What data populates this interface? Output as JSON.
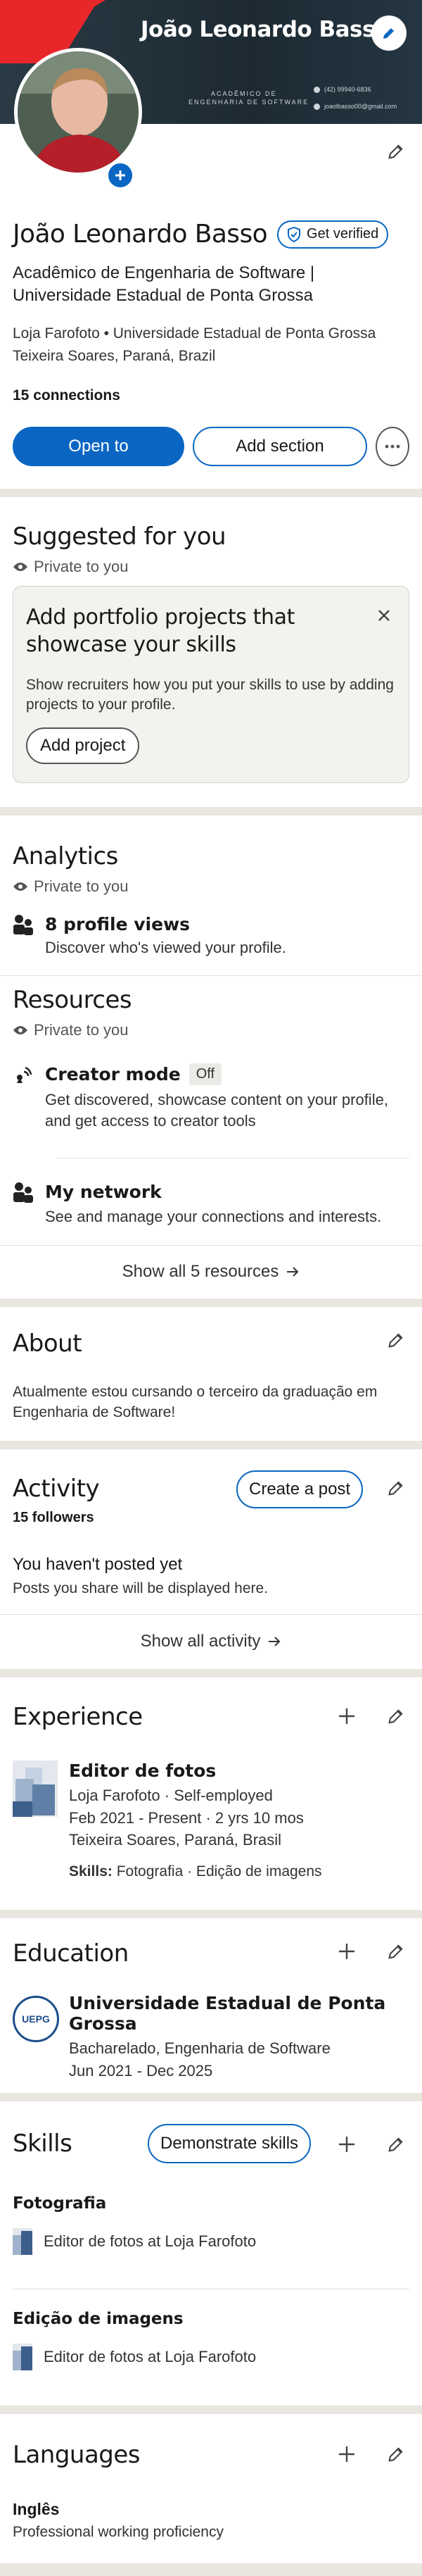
{
  "header": {
    "banner_name": "João Leonardo Basso",
    "banner_subtitle_line1": "ACADÊMICO DE",
    "banner_subtitle_line2": "ENGENHARIA DE SOFTWARE",
    "banner_phone": "(42) 99940-6836",
    "banner_email": "joaolbasso00@gmail.com"
  },
  "profile": {
    "name": "João Leonardo Basso",
    "verify_label": "Get verified",
    "headline": "Acadêmico de Engenharia de Software | Universidade Estadual de Ponta Grossa",
    "company_line": "Loja Farofoto • Universidade Estadual de Ponta Grossa",
    "location": "Teixeira Soares, Paraná, Brazil",
    "connections": "15 connections",
    "open_to_label": "Open to",
    "add_section_label": "Add section"
  },
  "suggested": {
    "title": "Suggested for you",
    "private_label": "Private to you",
    "card_title": "Add portfolio projects that showcase your skills",
    "card_text": "Show recruiters how you put your skills to use by adding projects to your profile.",
    "card_button": "Add project"
  },
  "analytics": {
    "title": "Analytics",
    "private_label": "Private to you",
    "views_title": "8 profile views",
    "views_sub": "Discover who's viewed your profile."
  },
  "resources": {
    "title": "Resources",
    "private_label": "Private to you",
    "creator_title": "Creator mode",
    "creator_badge": "Off",
    "creator_sub": "Get discovered, showcase content on your profile, and get access to creator tools",
    "network_title": "My network",
    "network_sub": "See and manage your connections and interests.",
    "show_all": "Show all 5 resources"
  },
  "about": {
    "title": "About",
    "text": "Atualmente estou cursando o terceiro da graduação em Engenharia de Software!"
  },
  "activity": {
    "title": "Activity",
    "followers": "15 followers",
    "create_post": "Create a post",
    "empty_title": "You haven't posted yet",
    "empty_sub": "Posts you share will be displayed here.",
    "show_all": "Show all activity"
  },
  "experience": {
    "title": "Experience",
    "role": "Editor de fotos",
    "company": "Loja Farofoto · Self-employed",
    "dates": "Feb 2021 - Present · 2 yrs 10 mos",
    "location": "Teixeira Soares, Paraná, Brasil",
    "skills_label": "Skills:",
    "skills": "Fotografia · Edição de imagens"
  },
  "education": {
    "title": "Education",
    "school": "Universidade Estadual de Ponta Grossa",
    "degree": "Bacharelado, Engenharia de Software",
    "dates": "Jun 2021 - Dec 2025",
    "logo_text": "UEPG"
  },
  "skills": {
    "title": "Skills",
    "demonstrate": "Demonstrate skills",
    "items": [
      {
        "name": "Fotografia",
        "context": "Editor de fotos at Loja Farofoto"
      },
      {
        "name": "Edição de imagens",
        "context": "Editor de fotos at Loja Farofoto"
      }
    ]
  },
  "languages": {
    "title": "Languages",
    "name": "Inglês",
    "level": "Professional working proficiency"
  },
  "colors": {
    "brand_blue": "#0a66c2",
    "banner_dark": "#1d2a33",
    "banner_red": "#e8272a"
  }
}
